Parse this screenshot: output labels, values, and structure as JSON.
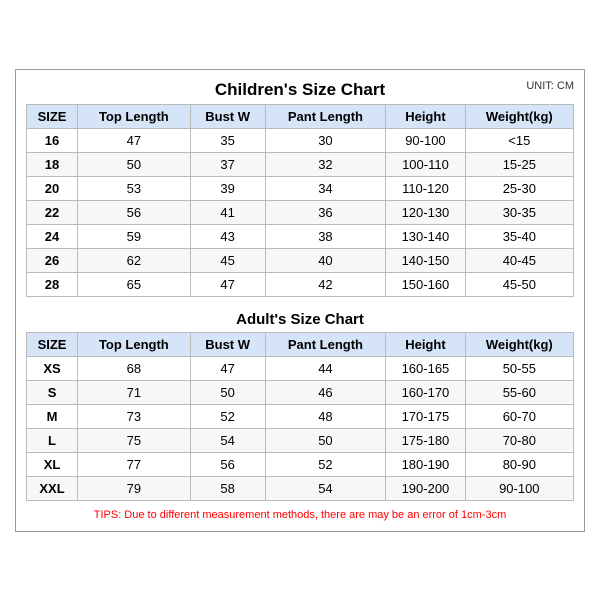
{
  "children_title": "Children's Size Chart",
  "adult_title": "Adult's Size Chart",
  "unit": "UNIT: CM",
  "columns": [
    "SIZE",
    "Top Length",
    "Bust W",
    "Pant Length",
    "Height",
    "Weight(kg)"
  ],
  "children_rows": [
    [
      "16",
      "47",
      "35",
      "30",
      "90-100",
      "<15"
    ],
    [
      "18",
      "50",
      "37",
      "32",
      "100-110",
      "15-25"
    ],
    [
      "20",
      "53",
      "39",
      "34",
      "110-120",
      "25-30"
    ],
    [
      "22",
      "56",
      "41",
      "36",
      "120-130",
      "30-35"
    ],
    [
      "24",
      "59",
      "43",
      "38",
      "130-140",
      "35-40"
    ],
    [
      "26",
      "62",
      "45",
      "40",
      "140-150",
      "40-45"
    ],
    [
      "28",
      "65",
      "47",
      "42",
      "150-160",
      "45-50"
    ]
  ],
  "adult_rows": [
    [
      "XS",
      "68",
      "47",
      "44",
      "160-165",
      "50-55"
    ],
    [
      "S",
      "71",
      "50",
      "46",
      "160-170",
      "55-60"
    ],
    [
      "M",
      "73",
      "52",
      "48",
      "170-175",
      "60-70"
    ],
    [
      "L",
      "75",
      "54",
      "50",
      "175-180",
      "70-80"
    ],
    [
      "XL",
      "77",
      "56",
      "52",
      "180-190",
      "80-90"
    ],
    [
      "XXL",
      "79",
      "58",
      "54",
      "190-200",
      "90-100"
    ]
  ],
  "tips": "TIPS: Due to different measurement methods, there are may be an error of 1cm-3cm"
}
